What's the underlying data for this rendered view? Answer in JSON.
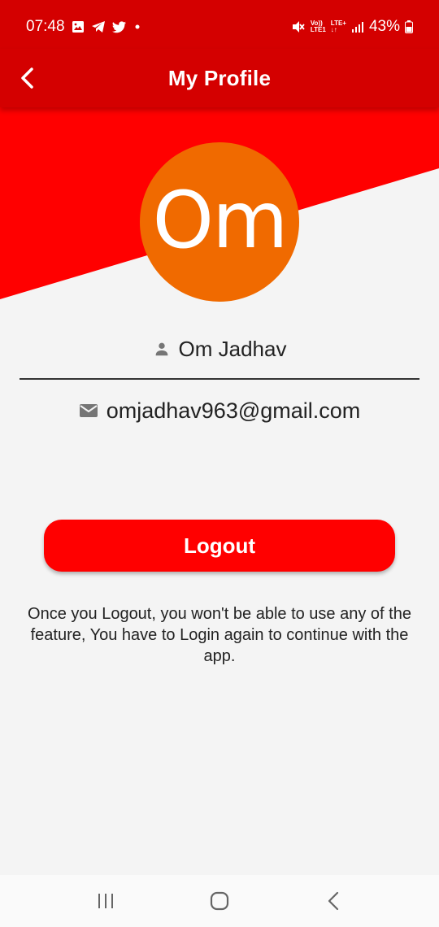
{
  "status_bar": {
    "time": "07:48",
    "network_top": "Vo))",
    "network_bottom": "LTE1",
    "lte_label": "LTE+",
    "battery": "43%"
  },
  "app_bar": {
    "title": "My Profile",
    "back_icon": "chevron-left-icon"
  },
  "profile": {
    "avatar_initials": "Om",
    "avatar_color": "#f06a00",
    "name": "Om Jadhav",
    "email": "omjadhav963@gmail.com"
  },
  "actions": {
    "logout_label": "Logout"
  },
  "note": "Once you Logout, you won't be able to use any of the feature, You have to Login again to continue with the app.",
  "colors": {
    "app_bar": "#d40000",
    "accent": "#ff0000",
    "background": "#f4f4f4"
  },
  "nav_bar": {
    "items": [
      "recent-apps-icon",
      "home-icon",
      "back-icon"
    ]
  }
}
